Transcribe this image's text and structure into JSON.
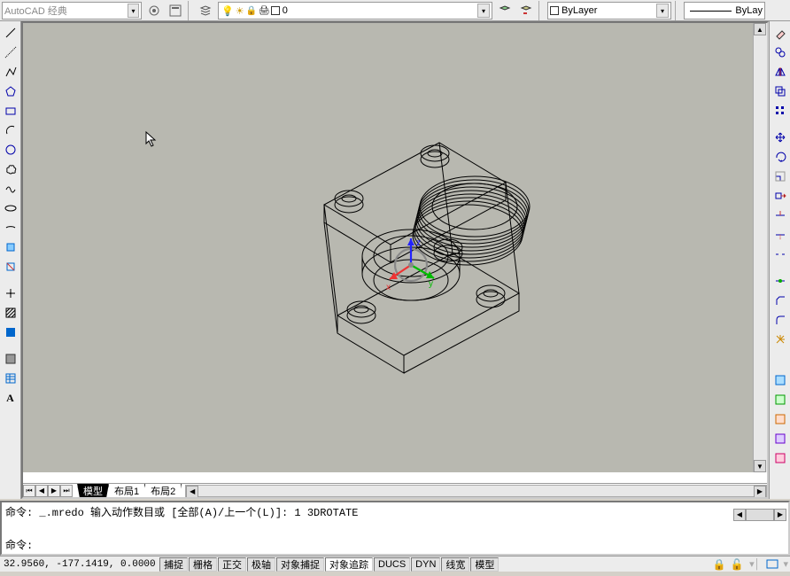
{
  "top": {
    "workspace": "AutoCAD 经典",
    "layer": "0",
    "color_layer": "ByLayer",
    "line_layer": "ByLay"
  },
  "tabs": {
    "model": "模型",
    "layout1": "布局1",
    "layout2": "布局2"
  },
  "command": {
    "line1": "命令: _.mredo 输入动作数目或 [全部(A)/上一个(L)]: 1 3DROTATE",
    "prompt": "命令:"
  },
  "status": {
    "coords": "32.9560,  -177.1419, 0.0000",
    "snap": "捕捉",
    "grid": "栅格",
    "ortho": "正交",
    "polar": "极轴",
    "osnap": "对象捕捉",
    "otrack": "对象追踪",
    "ducs": "DUCS",
    "dyn": "DYN",
    "lwt": "线宽",
    "model": "模型"
  },
  "axes": {
    "x": "x",
    "y": "y",
    "z": "z"
  }
}
